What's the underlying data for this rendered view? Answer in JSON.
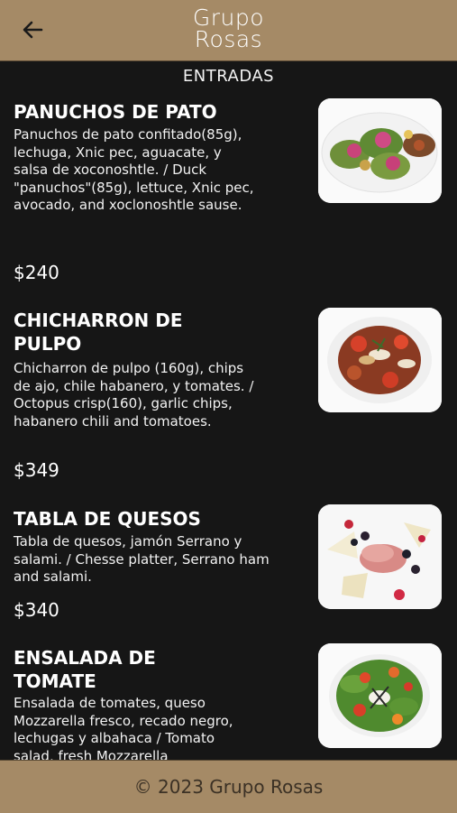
{
  "header": {
    "logo_line1": "Grupo",
    "logo_line2": "Rosas"
  },
  "section": {
    "title": "ENTRADAS"
  },
  "items": [
    {
      "name": "PANUCHOS DE PATO",
      "description": "Panuchos de pato confitado(85g), lechuga, Xnic pec, aguacate, y salsa de xoconoshtle. / Duck \"panuchos\"(85g), lettuce, Xnic pec, avocado, and xoclonoshtle sause.",
      "price": "$240",
      "image_icon": "duck-panuchos-photo"
    },
    {
      "name": "CHICHARRON DE PULPO",
      "description": "Chicharron de pulpo (160g), chips de ajo, chile habanero, y tomates. / Octopus crisp(160), garlic chips, habanero chili and tomatoes.",
      "price": "$349",
      "image_icon": "octopus-crisp-photo"
    },
    {
      "name": "TABLA DE QUESOS",
      "description": "Tabla de quesos, jamón Serrano y salami. / Chesse platter, Serrano ham and salami.",
      "price": "$340",
      "image_icon": "cheese-platter-photo"
    },
    {
      "name": "ENSALADA DE TOMATE",
      "description": "Ensalada de tomates, queso Mozzarella fresco, recado negro, lechugas y albahaca / Tomato salad, fresh Mozzarella",
      "price": "",
      "image_icon": "tomato-salad-photo"
    }
  ],
  "footer": {
    "copyright": "© 2023 Grupo Rosas"
  },
  "colors": {
    "bar": "#a58a66",
    "background": "#161616",
    "footer_text": "#3b3125"
  }
}
